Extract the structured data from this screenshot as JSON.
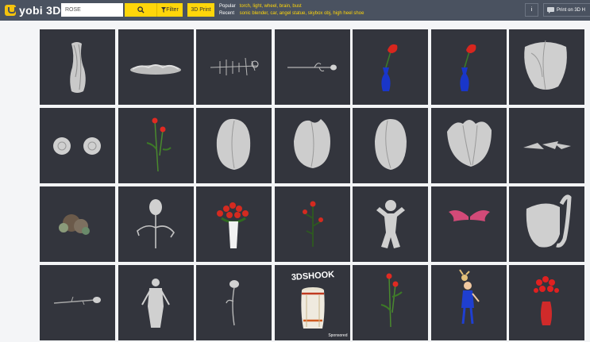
{
  "brand": {
    "logo_text": "yobi 3D",
    "accent_color": "#ffd60a",
    "topbar_color": "#4a5260",
    "tile_color": "#33353d"
  },
  "search": {
    "value": "ROSE",
    "button_icon": "search-icon"
  },
  "filter": {
    "label": "Filter",
    "icon": "funnel-icon"
  },
  "print_button": {
    "label": "3D Print"
  },
  "suggestions": {
    "popular_label": "Popular",
    "popular_items": "torch, light, wheel, brain, bust",
    "recent_label": "Recent",
    "recent_items": "sonic blender, car, angel statue, skybox obj, high heel shoe"
  },
  "menu_button": {
    "label": "i"
  },
  "print_on_3d": {
    "label": "Print on 3D H",
    "icon": "chat-bubble-icon"
  },
  "results": [
    {
      "name": "result-twisted-vase",
      "icon": "twisted-vase-icon"
    },
    {
      "name": "result-flat-dish",
      "icon": "flat-dish-icon"
    },
    {
      "name": "result-wire-rose-branch",
      "icon": "wire-branch-icon"
    },
    {
      "name": "result-rose-stem-long",
      "icon": "rose-stem-icon"
    },
    {
      "name": "result-red-rose-blue-vase-1",
      "icon": "rose-vase-icon"
    },
    {
      "name": "result-red-rose-blue-vase-2",
      "icon": "rose-vase-icon"
    },
    {
      "name": "result-rose-bud-large",
      "icon": "rose-bud-icon"
    },
    {
      "name": "result-two-rose-heads",
      "icon": "rose-heads-icon"
    },
    {
      "name": "result-two-red-roses",
      "icon": "red-roses-icon"
    },
    {
      "name": "result-tulip-bud-1",
      "icon": "tulip-bud-icon"
    },
    {
      "name": "result-tulip-bud-2",
      "icon": "tulip-bud-icon"
    },
    {
      "name": "result-tulip-bud-3",
      "icon": "tulip-bud-icon"
    },
    {
      "name": "result-tulip-bud-4",
      "icon": "tulip-bud-icon"
    },
    {
      "name": "result-flat-petals",
      "icon": "flat-petals-icon"
    },
    {
      "name": "result-rock-cluster",
      "icon": "rock-cluster-icon"
    },
    {
      "name": "result-rose-stem-arched",
      "icon": "arched-rose-icon"
    },
    {
      "name": "result-roses-white-vase",
      "icon": "rose-bouquet-icon"
    },
    {
      "name": "result-rose-bush",
      "icon": "rose-bush-icon"
    },
    {
      "name": "result-figure-statue",
      "icon": "figure-statue-icon"
    },
    {
      "name": "result-pink-wings",
      "icon": "wings-icon"
    },
    {
      "name": "result-rose-bud-open",
      "icon": "rose-bud-icon"
    },
    {
      "name": "result-rose-branch-horizontal",
      "icon": "rose-branch-icon"
    },
    {
      "name": "result-woman-figure",
      "icon": "woman-figure-icon"
    },
    {
      "name": "result-single-rose-gray",
      "icon": "rose-stem-icon"
    },
    {
      "name": "result-sponsored-drum",
      "icon": "drum-icon",
      "brand_text": "3DSHOOK",
      "badge": "Sponsored"
    },
    {
      "name": "result-red-roses-tall",
      "icon": "red-roses-icon"
    },
    {
      "name": "result-dancing-girl",
      "icon": "dancing-girl-icon"
    },
    {
      "name": "result-red-rose-vase",
      "icon": "red-vase-icon"
    }
  ]
}
